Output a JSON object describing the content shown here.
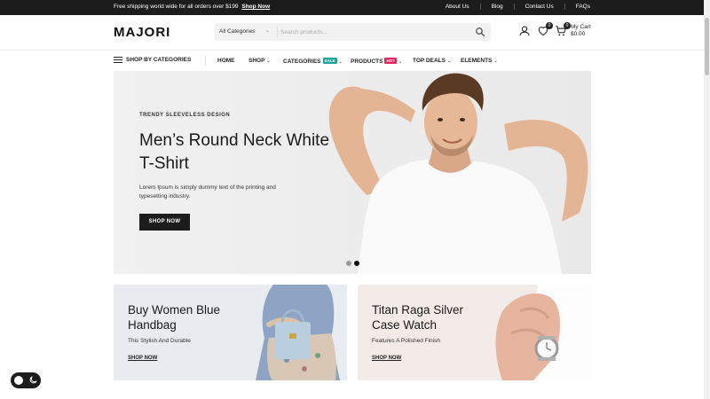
{
  "topbar": {
    "promo_text": "Free shipping world wide for all orders over $199",
    "promo_link": "Shop Now",
    "links": [
      "About Us",
      "Blog",
      "Contact Us",
      "FAQs"
    ]
  },
  "header": {
    "logo": "MAJORI",
    "search": {
      "category": "All Categories",
      "placeholder": "Search products..."
    },
    "wishlist_count": "0",
    "cart_count": "0",
    "cart_label": "My Cart",
    "cart_total": "$0.00"
  },
  "nav": {
    "shop_by_categories": "SHOP BY CATEGORIES",
    "items": {
      "home": "HOME",
      "shop": "SHOP",
      "categories": "CATEGORIES",
      "categories_tag": "SALE",
      "products": "PRODUCTS",
      "products_tag": "HOT",
      "top_deals": "TOP DEALS",
      "elements": "ELEMENTS"
    }
  },
  "hero": {
    "eyebrow": "TRENDY SLEEVELESS DESIGN",
    "title": "Men’s Round Neck White T-Shirt",
    "description": "Lorem Ipsum is simply dummy text of the printing and typesetting industry.",
    "button": "SHOP NOW",
    "slides": 2,
    "active_slide": 2
  },
  "banners": [
    {
      "title": "Buy Women Blue Handbag",
      "subtitle": "This Stylish And Durable",
      "link": "SHOP NOW"
    },
    {
      "title": "Titan Raga Silver Case Watch",
      "subtitle": "Features A Polished Finish",
      "link": "SHOP NOW"
    }
  ],
  "colors": {
    "dark": "#1c1c1c",
    "sale_tag": "#1aa39a",
    "hot_tag": "#e5245e",
    "banner1_bg": "#e8ebf0",
    "banner2_bg": "#f3ebe8"
  },
  "icons": [
    "search-icon",
    "user-icon",
    "heart-icon",
    "cart-icon",
    "menu-icon",
    "moon-icon",
    "chevron-down-icon"
  ]
}
